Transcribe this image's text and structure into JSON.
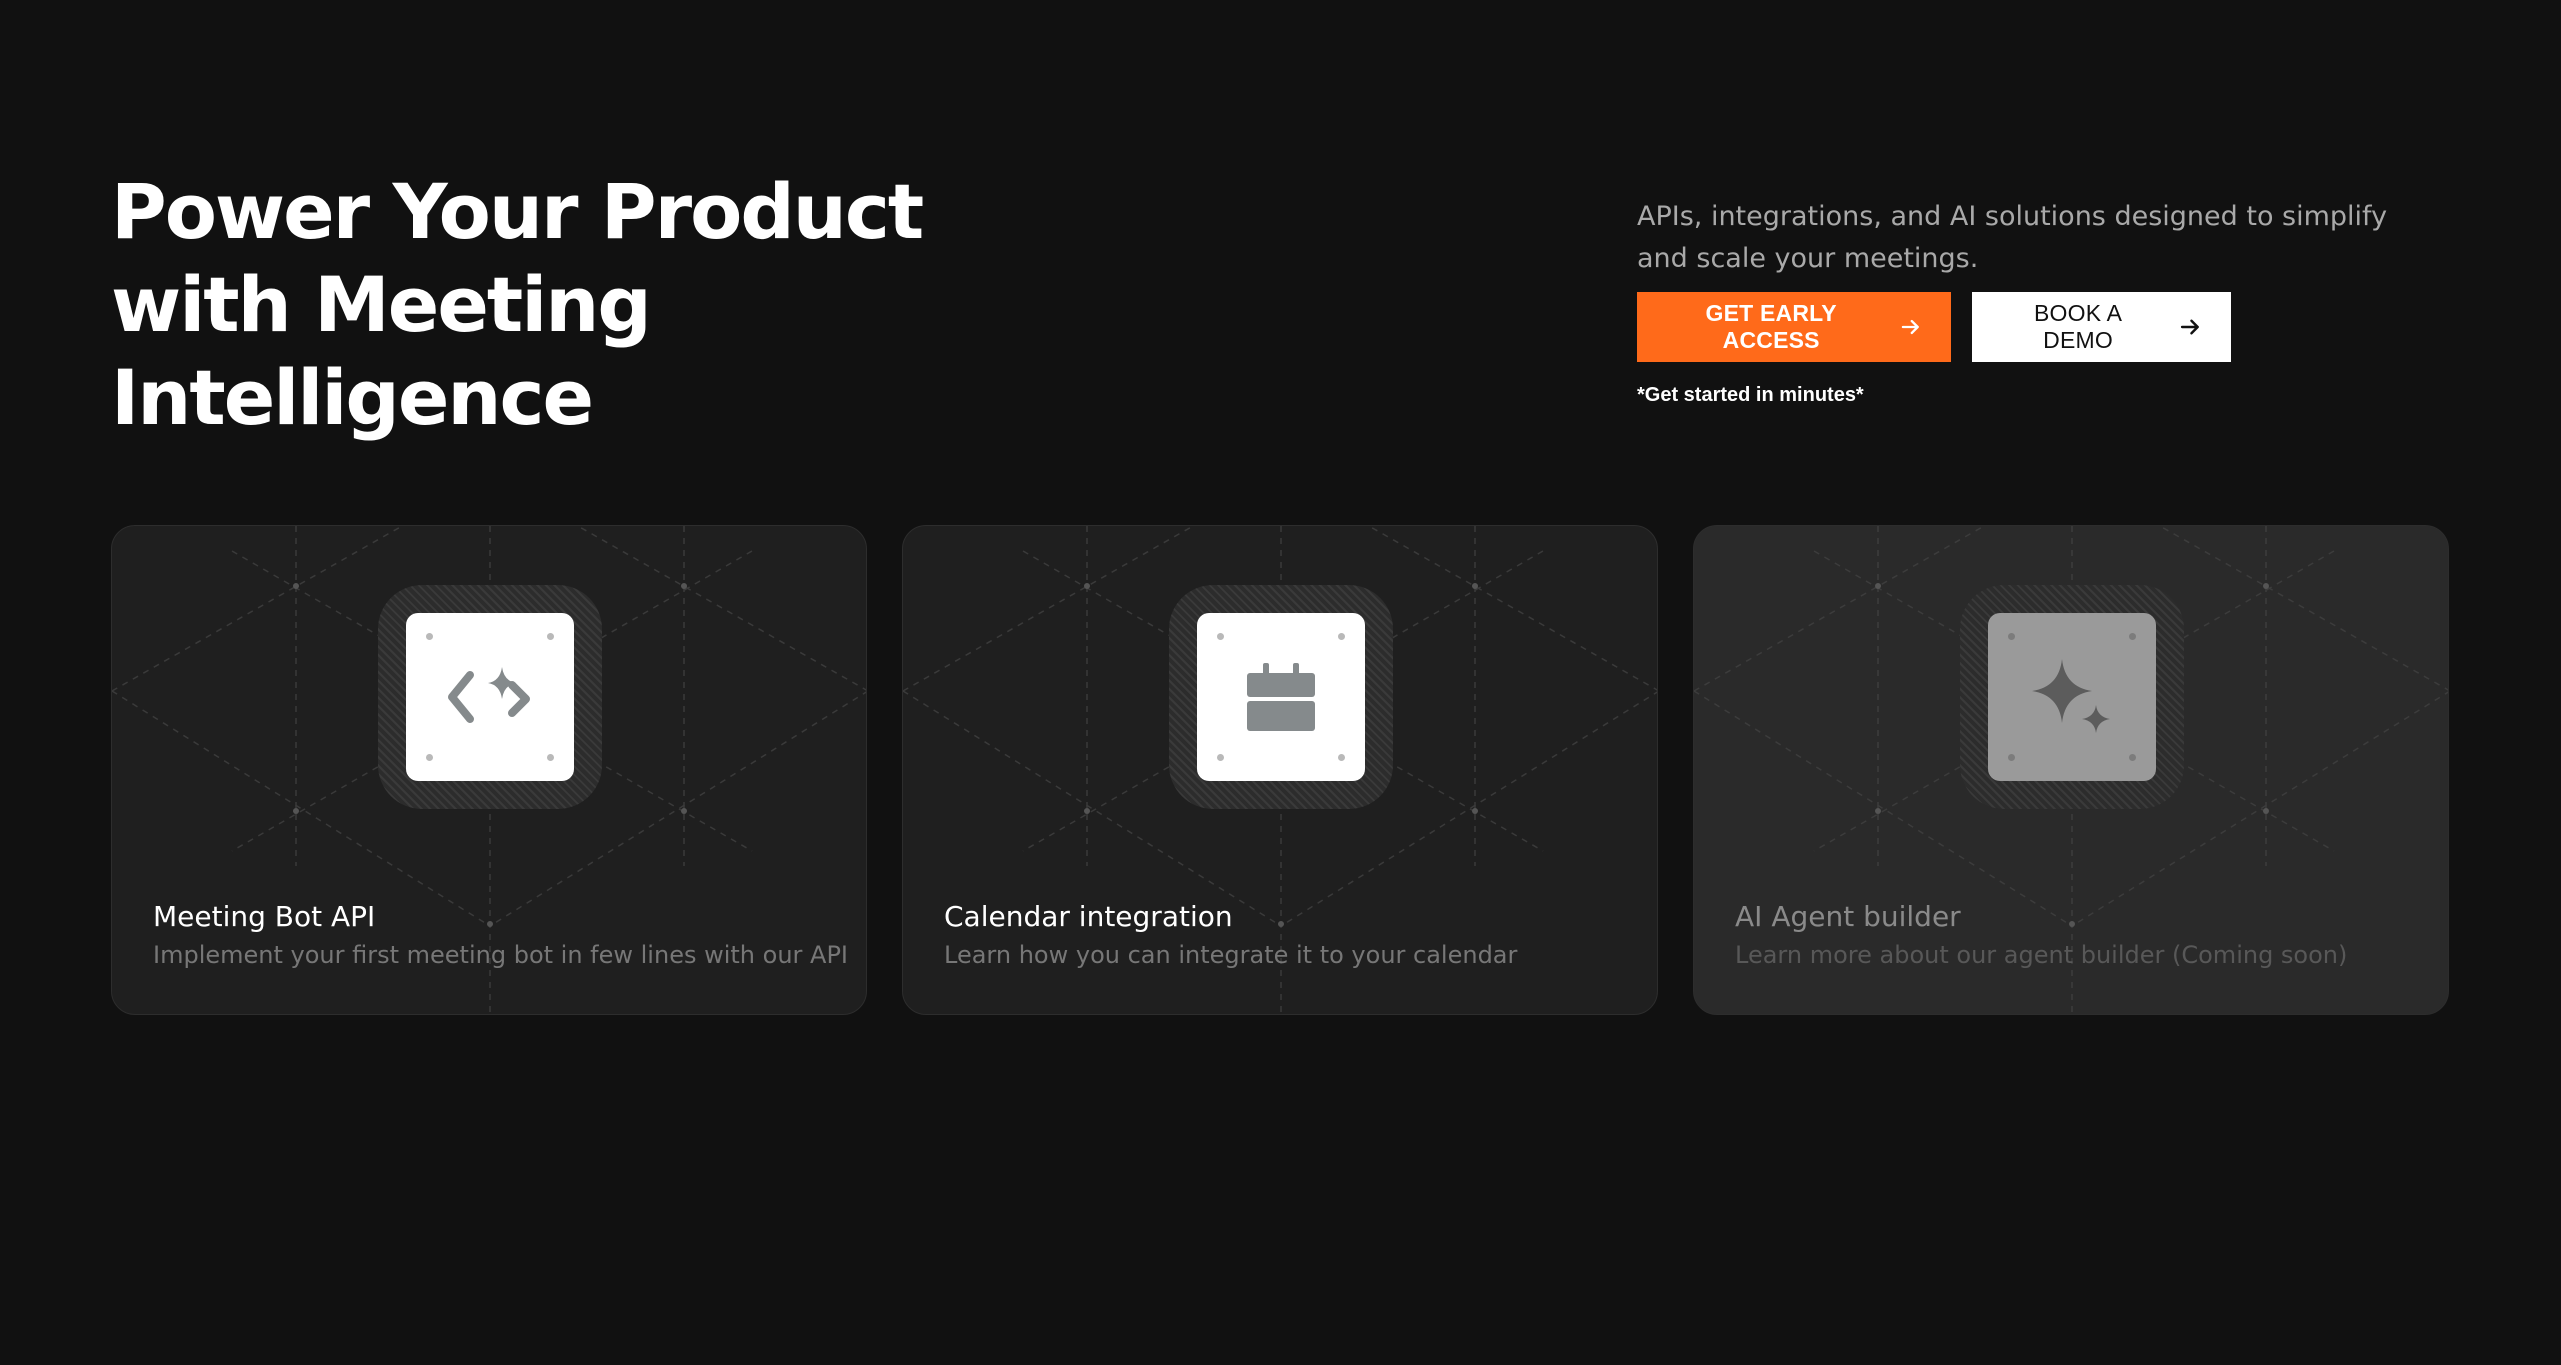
{
  "hero": {
    "title_lines": [
      "Power Your Product",
      "with Meeting",
      "Intelligence"
    ],
    "subtitle": "APIs, integrations, and AI solutions designed to simplify and scale your meetings.",
    "primary_button": "GET EARLY ACCESS",
    "secondary_button": "BOOK A DEMO",
    "note": "*Get started in minutes*"
  },
  "cards": [
    {
      "title": "Meeting Bot API",
      "description": "Implement your first meeting bot in few lines with our API",
      "icon": "code-sparkle-icon",
      "disabled": false
    },
    {
      "title": "Calendar integration",
      "description": "Learn how you can integrate it to your calendar",
      "icon": "calendar-icon",
      "disabled": false
    },
    {
      "title": "AI Agent builder",
      "description": "Learn more about our agent builder  (Coming soon)",
      "icon": "sparkles-icon",
      "disabled": true
    }
  ],
  "colors": {
    "background": "#111111",
    "accent": "#ff6a1a",
    "card": "#1f1f1f"
  }
}
